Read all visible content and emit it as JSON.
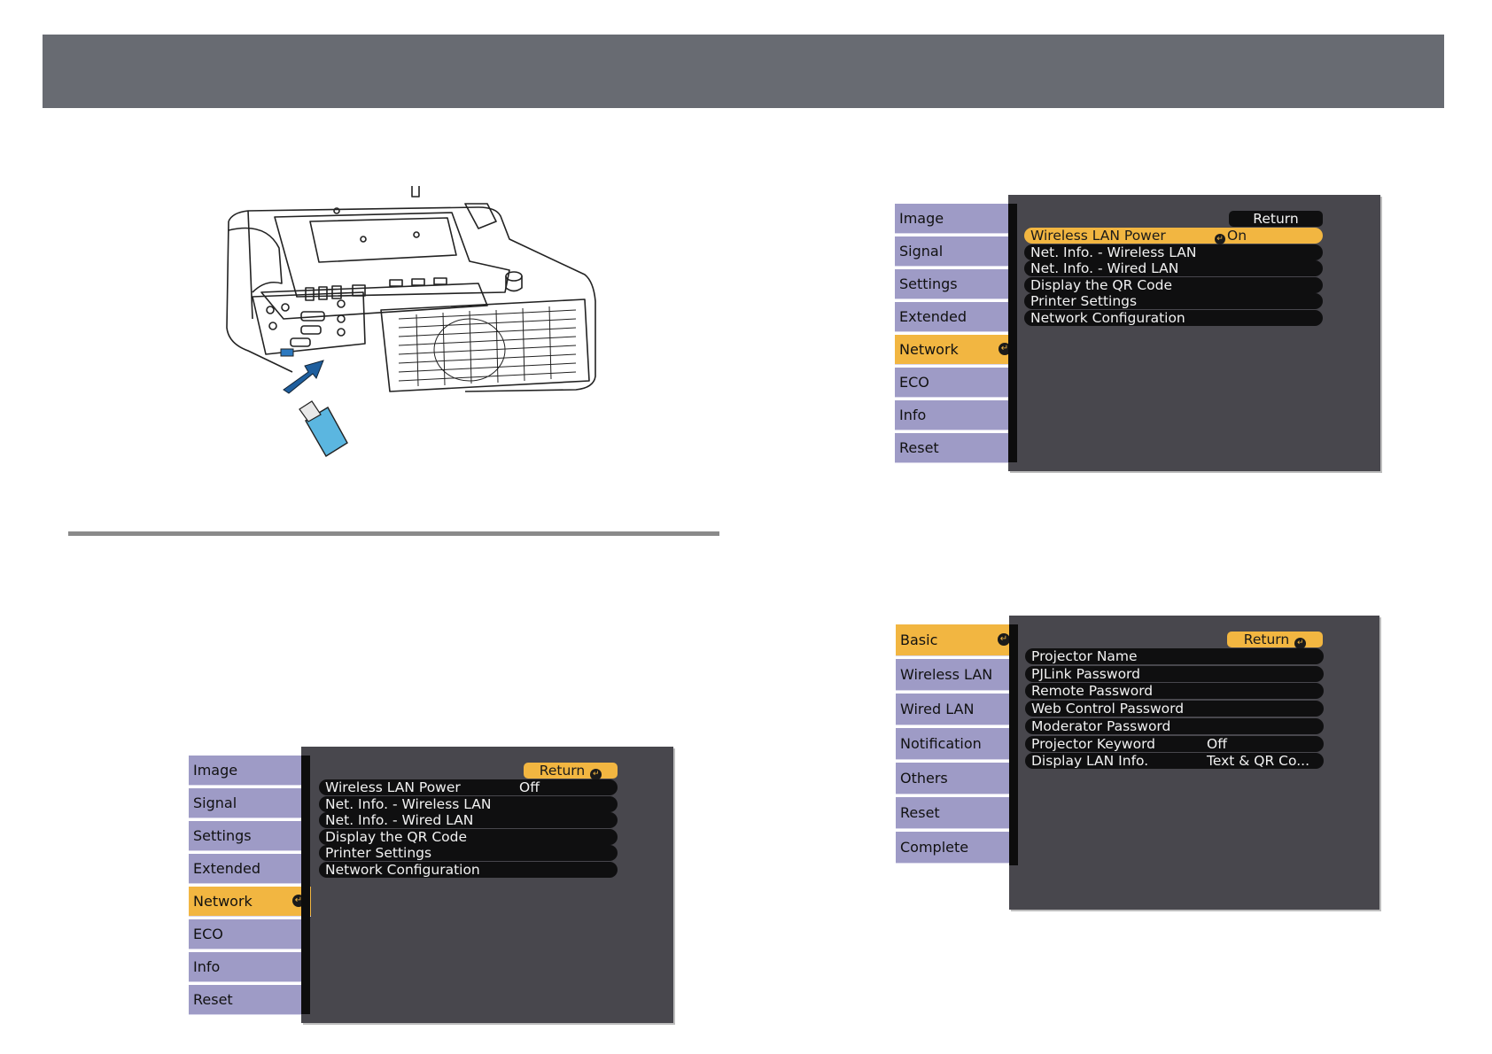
{
  "colors": {
    "header": "#686b72",
    "tab": "#9e9bc6",
    "active": "#f2b641",
    "panel": "#48474d",
    "row": "#0f0f10"
  },
  "menu_top": {
    "tabs": [
      "Image",
      "Signal",
      "Settings",
      "Extended",
      "Network",
      "ECO",
      "Info",
      "Reset"
    ],
    "active_tab": "Network",
    "return_label": "Return",
    "rows": [
      {
        "label": "Wireless LAN Power",
        "value": "On",
        "highlighted": true
      },
      {
        "label": "Net. Info. - Wireless LAN",
        "value": ""
      },
      {
        "label": "Net. Info. - Wired LAN",
        "value": ""
      },
      {
        "label": "Display the QR Code",
        "value": ""
      },
      {
        "label": "Printer Settings",
        "value": ""
      },
      {
        "label": "Network Configuration",
        "value": ""
      }
    ]
  },
  "menu_bottom_left": {
    "tabs": [
      "Image",
      "Signal",
      "Settings",
      "Extended",
      "Network",
      "ECO",
      "Info",
      "Reset"
    ],
    "active_tab": "Network",
    "return_label": "Return",
    "rows": [
      {
        "label": "Wireless LAN Power",
        "value": "Off"
      },
      {
        "label": "Net. Info. - Wireless LAN",
        "value": ""
      },
      {
        "label": "Net. Info. - Wired LAN",
        "value": ""
      },
      {
        "label": "Display the QR Code",
        "value": ""
      },
      {
        "label": "Printer Settings",
        "value": ""
      },
      {
        "label": "Network Configuration",
        "value": ""
      }
    ]
  },
  "menu_bottom_right": {
    "tabs": [
      "Basic",
      "Wireless LAN",
      "Wired LAN",
      "Notification",
      "Others",
      "Reset",
      "Complete"
    ],
    "active_tab": "Basic",
    "return_label": "Return",
    "rows": [
      {
        "label": "Projector Name",
        "value": ""
      },
      {
        "label": "PJLink Password",
        "value": ""
      },
      {
        "label": "Remote Password",
        "value": ""
      },
      {
        "label": "Web Control Password",
        "value": ""
      },
      {
        "label": "Moderator Password",
        "value": ""
      },
      {
        "label": "Projector Keyword",
        "value": "Off"
      },
      {
        "label": "Display LAN Info.",
        "value": "Text & QR Co..."
      }
    ]
  }
}
